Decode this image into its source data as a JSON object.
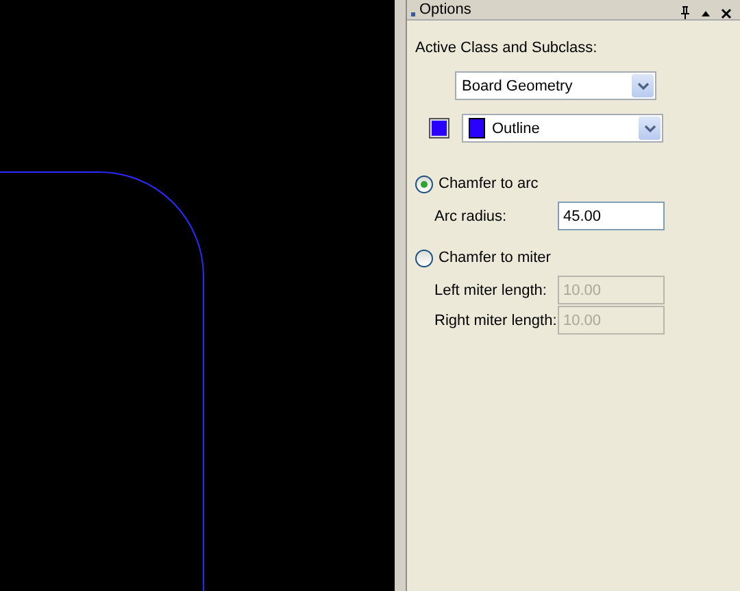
{
  "panel": {
    "title": "Options"
  },
  "class_label": "Active Class and Subclass:",
  "class_dropdown": {
    "value": "Board Geometry"
  },
  "subclass_dropdown": {
    "value": "Outline",
    "color": "#2a00ff"
  },
  "options": [
    {
      "label": "Chamfer to arc",
      "selected": true,
      "fields": [
        {
          "label": "Arc radius:",
          "value": "45.00",
          "disabled": false
        }
      ]
    },
    {
      "label": "Chamfer to miter",
      "selected": false,
      "fields": [
        {
          "label": "Left miter length:",
          "value": "10.00",
          "disabled": true
        },
        {
          "label": "Right miter length:",
          "value": "10.00",
          "disabled": true
        }
      ]
    }
  ]
}
